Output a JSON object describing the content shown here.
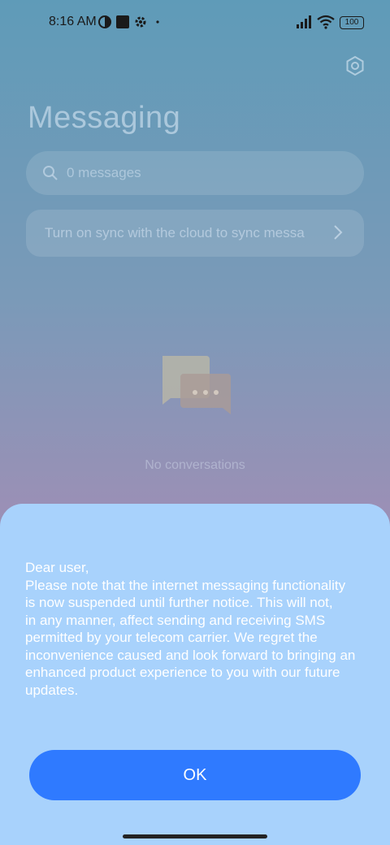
{
  "status_bar": {
    "time": "8:16 AM",
    "battery": "100"
  },
  "header": {
    "title": "Messaging"
  },
  "search": {
    "placeholder": "0 messages"
  },
  "sync_banner": {
    "text": "Turn on sync with the cloud to sync messa"
  },
  "empty_state": {
    "text": "No conversations"
  },
  "dialog": {
    "message_lines": [
      "Dear user,",
      "Please note that the internet messaging functionality",
      "is now suspended until further notice. This will not,",
      "in any manner, affect sending and receiving SMS",
      "permitted by your telecom carrier. We regret the",
      "inconvenience caused and look forward to bringing an",
      "enhanced product experience to you with our future",
      "updates."
    ],
    "ok_label": "OK"
  },
  "colors": {
    "dialog_bg": "#a8d2fc",
    "ok_button": "#2f7aff"
  }
}
